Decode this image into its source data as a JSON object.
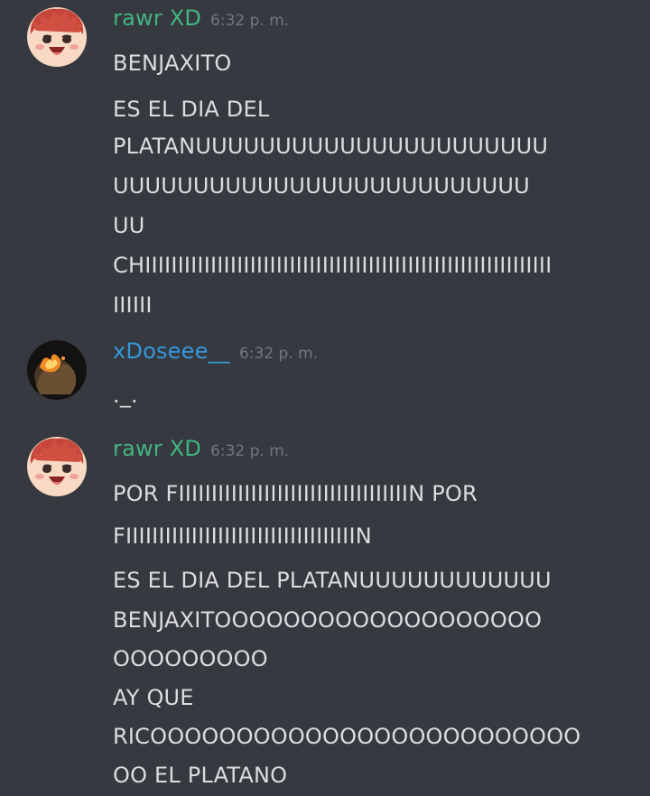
{
  "colors": {
    "background": "#36393f",
    "text": "#dcddde",
    "timestamp": "#72767d",
    "user_green": "#43b581",
    "user_blue": "#3498db"
  },
  "messages": [
    {
      "username": "rawr XD",
      "timestamp": "6:32 p. m.",
      "avatar_icon": "anime-boy-avatar",
      "lines": [
        "BENJAXITO",
        "ES EL DIA DEL",
        "PLATANUUUUUUUUUUUUUUUUUUUUUU",
        "UUUUUUUUUUUUUUUUUUUUUUUUUU",
        "UU",
        "CHIIIIIIIIIIIIIIIIIIIIIIIIIIIIIIIIIIIIIIIIIIIIIIIIIIIIIIIIIIIIII",
        "IIIIII"
      ]
    },
    {
      "username": "xDoseee__",
      "timestamp": "6:32 p. m.",
      "avatar_icon": "fire-photo-avatar",
      "lines": [
        "._."
      ]
    },
    {
      "username": "rawr XD",
      "timestamp": "6:32 p. m.",
      "avatar_icon": "anime-boy-avatar",
      "lines": [
        "POR FIIIIIIIIIIIIIIIIIIIIIIIIIIIIIIIIIIIN POR",
        "FIIIIIIIIIIIIIIIIIIIIIIIIIIIIIIIIIIIN",
        "ES EL DIA DEL PLATANUUUUUUUUUUUU",
        "BENJAXITOOOOOOOOOOOOOOOOOOO",
        "OOOOOOOOO",
        "AY QUE",
        "RICOOOOOOOOOOOOOOOOOOOOOOOOO",
        "OO EL PLATANO"
      ]
    }
  ]
}
